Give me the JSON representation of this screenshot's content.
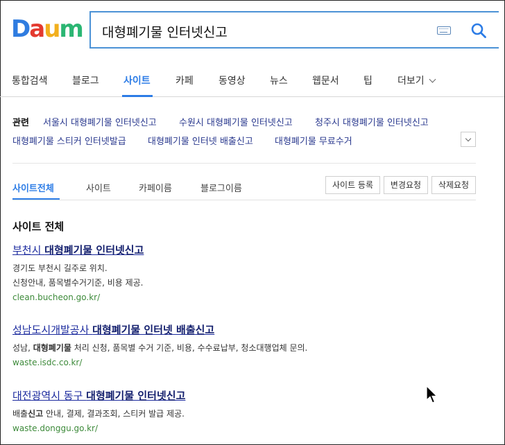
{
  "brand": {
    "logo_letters": [
      "D",
      "a",
      "u",
      "m",
      ""
    ]
  },
  "search": {
    "query": "대형폐기물 인터넷신고"
  },
  "tabs": [
    {
      "label": "통합검색"
    },
    {
      "label": "블로그"
    },
    {
      "label": "사이트"
    },
    {
      "label": "카페"
    },
    {
      "label": "동영상"
    },
    {
      "label": "뉴스"
    },
    {
      "label": "웹문서"
    },
    {
      "label": "팁"
    },
    {
      "label": "더보기"
    }
  ],
  "related": {
    "label": "관련",
    "links": [
      "서울시 대형폐기물 인터넷신고",
      "수원시 대형폐기물 인터넷신고",
      "청주시 대형폐기물 인터넷신고",
      "대형폐기물 스티커 인터넷발급",
      "대형폐기물 인터넷 배출신고",
      "대형폐기물 무료수거"
    ]
  },
  "subtabs": [
    {
      "label": "사이트전체"
    },
    {
      "label": "사이트"
    },
    {
      "label": "카페이름"
    },
    {
      "label": "블로그이름"
    }
  ],
  "actions": {
    "register": "사이트 등록",
    "change": "변경요청",
    "delete": "삭제요청"
  },
  "section_title": "사이트 전체",
  "results": [
    {
      "title_prefix": "부천시 ",
      "title_bold": "대형폐기물 인터넷신고",
      "title_suffix": "",
      "desc_line1": "경기도 부천시 길주로 위치.",
      "desc_line2": "신청안내, 품목별수거기준, 비용 제공.",
      "url": "clean.bucheon.go.kr/"
    },
    {
      "title_prefix": "성남도시개발공사 ",
      "title_bold": "대형폐기물 인터넷 배출신고",
      "title_suffix": "",
      "desc_pre": "성남, ",
      "desc_bold": "대형폐기물",
      "desc_post": " 처리 신청, 품목별 수거 기준, 비용, 수수료납부, 청소대행업체 문의.",
      "url": "waste.isdc.co.kr/"
    },
    {
      "title_prefix": "대전광역시 동구 ",
      "title_bold": "대형폐기물 인터넷신고",
      "title_suffix": "",
      "desc_pre": "배출",
      "desc_bold": "신고",
      "desc_post": " 안내, 결제, 결과조회, 스티커 발급 제공.",
      "url": "waste.donggu.go.kr/"
    }
  ]
}
